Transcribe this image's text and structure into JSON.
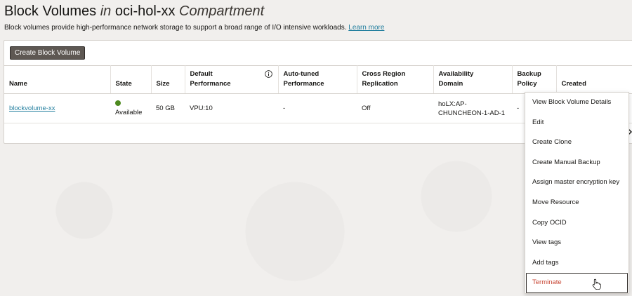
{
  "header": {
    "title_main": "Block Volumes",
    "title_in": "in",
    "title_compartment": "oci-hol-xx",
    "title_suffix": "Compartment",
    "description": "Block volumes provide high-performance network storage to support a broad range of I/O intensive workloads.",
    "learn_more": "Learn more"
  },
  "toolbar": {
    "create_label": "Create Block Volume"
  },
  "table": {
    "columns": [
      [
        "Name"
      ],
      [
        "State"
      ],
      [
        "Size"
      ],
      [
        "Default",
        "Performance"
      ],
      [
        "Auto-tuned",
        "Performance"
      ],
      [
        "Cross Region",
        "Replication"
      ],
      [
        "Availability",
        "Domain"
      ],
      [
        "Backup",
        "Policy"
      ],
      [
        "Created"
      ]
    ],
    "rows": [
      {
        "name": "blockvolume-xx",
        "state": "Available",
        "size": "50 GB",
        "default_performance": "VPU:10",
        "auto_tuned": "-",
        "cross_region": "Off",
        "availability_domain": [
          "hoLX:AP-",
          "CHUNCHEON-1-AD-1"
        ],
        "backup_policy": "-",
        "created": ""
      }
    ]
  },
  "menu": {
    "items": [
      "View Block Volume Details",
      "Edit",
      "Create Clone",
      "Create Manual Backup",
      "Assign master encryption key",
      "Move Resource",
      "Copy OCID",
      "View tags",
      "Add tags",
      "Terminate"
    ]
  },
  "colors": {
    "link": "#227e9e",
    "available": "#4d8a1f",
    "danger": "#c74634",
    "button_bg": "#5e5853"
  }
}
